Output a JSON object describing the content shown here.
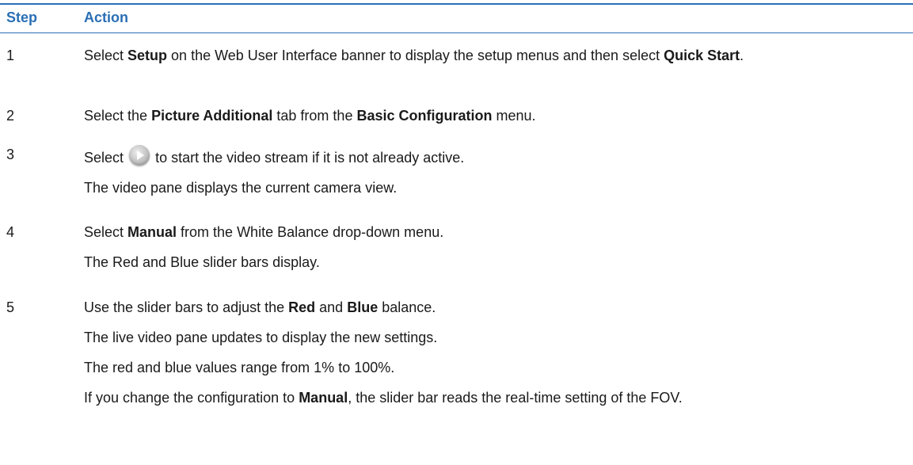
{
  "table": {
    "headers": {
      "step": "Step",
      "action": "Action"
    },
    "rows": [
      {
        "step": "1",
        "line1_a": "Select ",
        "line1_b": "Setup",
        "line1_c": " on the Web User Interface banner to display the setup menus and then select ",
        "line1_d": "Quick Start",
        "line1_e": "."
      },
      {
        "step": "2",
        "line1_a": "Select the ",
        "line1_b": "Picture Additional",
        "line1_c": " tab from the ",
        "line1_d": "Basic Configuration",
        "line1_e": " menu."
      },
      {
        "step": "3",
        "line1_a": "Select",
        "icon": "play-icon",
        "line1_c": "to start the video stream if it is not already active.",
        "line2": "The video pane displays the current camera view."
      },
      {
        "step": "4",
        "line1_a": "Select ",
        "line1_b": "Manual",
        "line1_c": " from the White Balance drop-down menu.",
        "line2": "The Red and Blue slider bars display."
      },
      {
        "step": "5",
        "line1_a": "Use the slider bars to adjust the ",
        "line1_b": "Red",
        "line1_c": " and ",
        "line1_d": "Blue",
        "line1_e": " balance.",
        "line2": "The live video pane updates to display the new settings.",
        "line3": "The red and blue values range from 1% to 100%.",
        "line4_a": "If you change the configuration to ",
        "line4_b": "Manual",
        "line4_c": ", the slider bar reads the real-time setting of the FOV."
      }
    ]
  }
}
